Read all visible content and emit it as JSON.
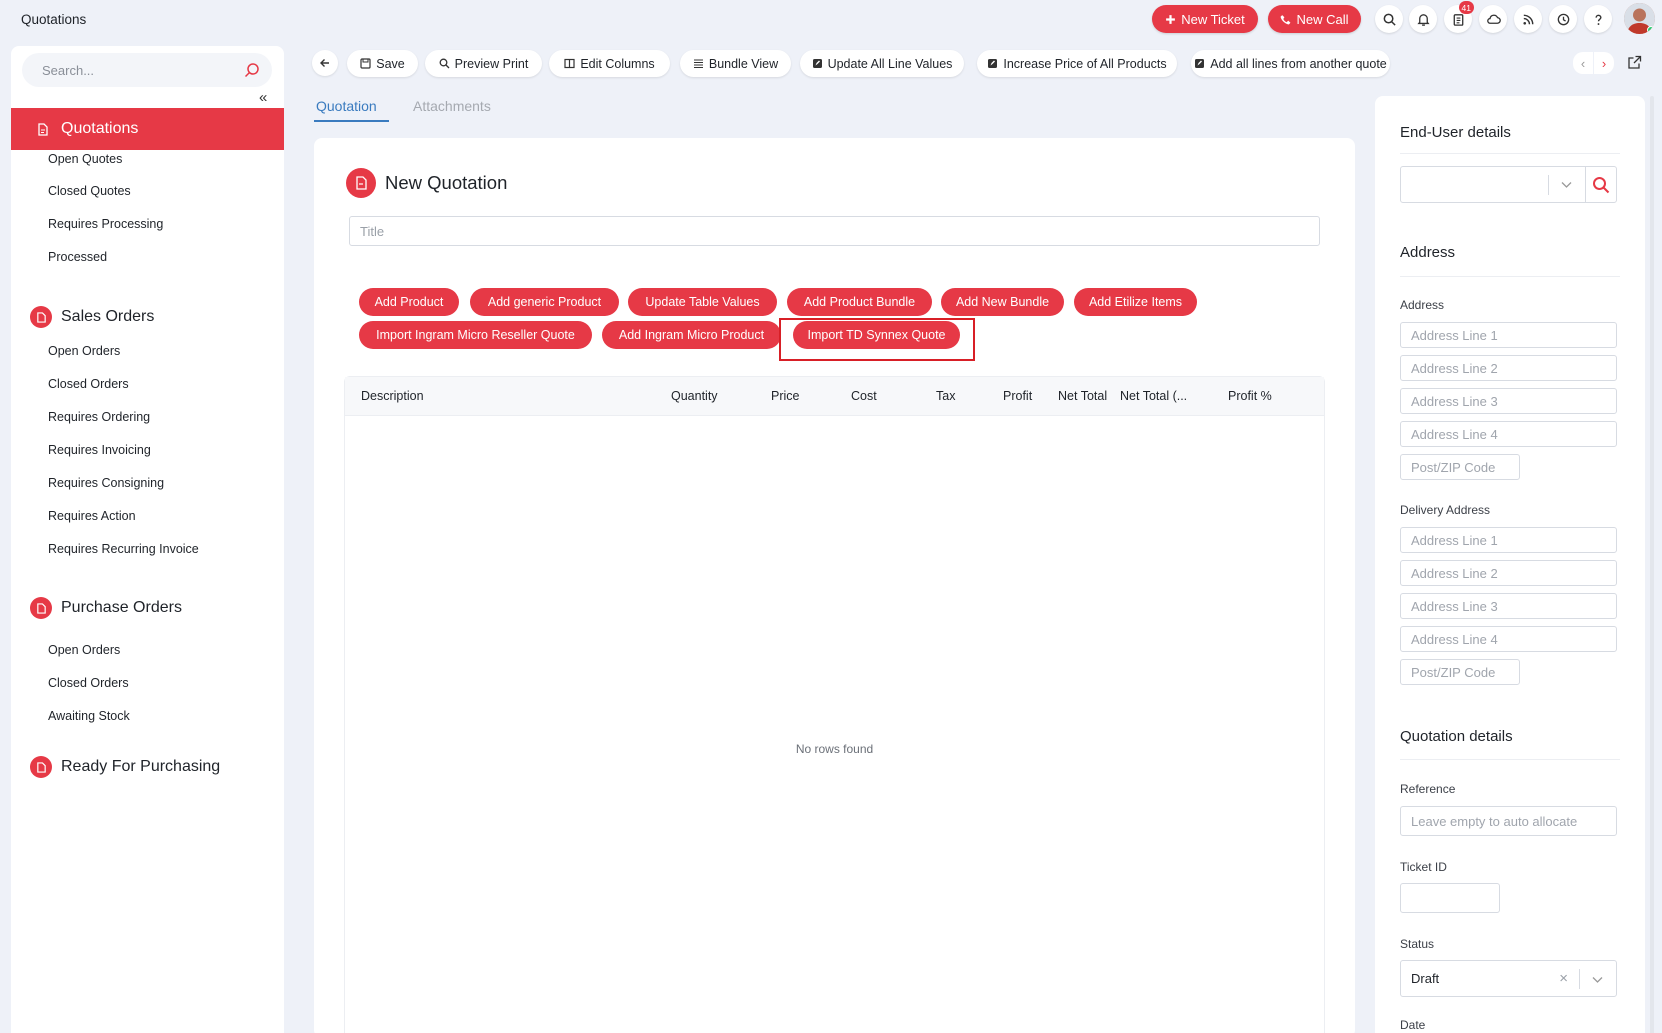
{
  "app": {
    "title": "Quotations"
  },
  "topbar": {
    "new_ticket": "New Ticket",
    "new_call": "New Call",
    "notification_count": "41",
    "icons": [
      "search-icon",
      "bell-icon",
      "clipboard-icon",
      "cloud-icon",
      "rss-icon",
      "clock-icon",
      "help-icon"
    ]
  },
  "sidebar": {
    "search_placeholder": "Search...",
    "collapse_symbol": "«",
    "active_section": "Quotations",
    "quotation_items": [
      "Open Quotes",
      "Closed Quotes",
      "Requires Processing",
      "Processed"
    ],
    "sales_orders": {
      "label": "Sales Orders",
      "items": [
        "Open Orders",
        "Closed Orders",
        "Requires Ordering",
        "Requires Invoicing",
        "Requires Consigning",
        "Requires Action",
        "Requires Recurring Invoice"
      ]
    },
    "purchase_orders": {
      "label": "Purchase Orders",
      "items": [
        "Open Orders",
        "Closed Orders",
        "Awaiting Stock"
      ]
    },
    "ready_for_purchasing": "Ready For Purchasing"
  },
  "toolbar": {
    "save": "Save",
    "preview_print": "Preview Print",
    "edit_columns": "Edit Columns",
    "bundle_view": "Bundle View",
    "update_all_line_values": "Update All Line Values",
    "increase_price": "Increase Price of All Products",
    "add_all_lines": "Add all lines from another quote",
    "prev": "‹",
    "next": "›"
  },
  "tabs": [
    "Quotation",
    "Attachments"
  ],
  "quotation": {
    "heading": "New Quotation",
    "title_placeholder": "Title",
    "actions": [
      "Add Product",
      "Add generic Product",
      "Update Table Values",
      "Add Product Bundle",
      "Add New Bundle",
      "Add Etilize Items",
      "Import Ingram Micro Reseller Quote",
      "Add Ingram Micro Product",
      "Import TD Synnex Quote"
    ],
    "columns": [
      "Description",
      "Quantity",
      "Price",
      "Cost",
      "Tax",
      "Profit",
      "Net Total",
      "Net Total (...",
      "Profit %"
    ],
    "empty_message": "No rows found"
  },
  "right_panel": {
    "end_user_heading": "End-User details",
    "address_heading": "Address",
    "address_label": "Address",
    "address_placeholders": [
      "Address Line 1",
      "Address Line 2",
      "Address Line 3",
      "Address Line 4",
      "Post/ZIP Code"
    ],
    "delivery_label": "Delivery Address",
    "delivery_placeholders": [
      "Address Line 1",
      "Address Line 2",
      "Address Line 3",
      "Address Line 4",
      "Post/ZIP Code"
    ],
    "details_heading": "Quotation details",
    "reference_label": "Reference",
    "reference_placeholder": "Leave empty to auto allocate",
    "ticket_label": "Ticket ID",
    "status_label": "Status",
    "status_value": "Draft",
    "status_clear": "×",
    "date_label": "Date"
  },
  "colors": {
    "accent": "#e63946",
    "tab_active": "#3a7bbf",
    "highlight": "#d81f26"
  }
}
